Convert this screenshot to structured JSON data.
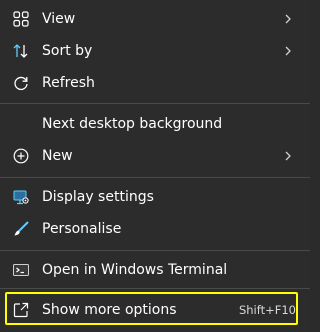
{
  "menu": {
    "items": [
      {
        "label": "View",
        "icon": "grid-icon",
        "has_submenu": true
      },
      {
        "label": "Sort by",
        "icon": "sort-arrows-icon",
        "has_submenu": true
      },
      {
        "label": "Refresh",
        "icon": "refresh-icon",
        "has_submenu": false
      },
      {
        "label": "Next desktop background",
        "icon": "",
        "has_submenu": false
      },
      {
        "label": "New",
        "icon": "plus-circle-icon",
        "has_submenu": true
      },
      {
        "label": "Display settings",
        "icon": "display-settings-icon",
        "has_submenu": false
      },
      {
        "label": "Personalise",
        "icon": "brush-icon",
        "has_submenu": false
      },
      {
        "label": "Open in Windows Terminal",
        "icon": "terminal-icon",
        "has_submenu": false
      },
      {
        "label": "Show more options",
        "icon": "share-box-icon",
        "has_submenu": false,
        "shortcut": "Shift+F10"
      }
    ]
  },
  "colors": {
    "background": "#2c2c2c",
    "text": "#ffffff",
    "highlight_border": "#ffff00",
    "accent_icon": "#60cdff"
  }
}
